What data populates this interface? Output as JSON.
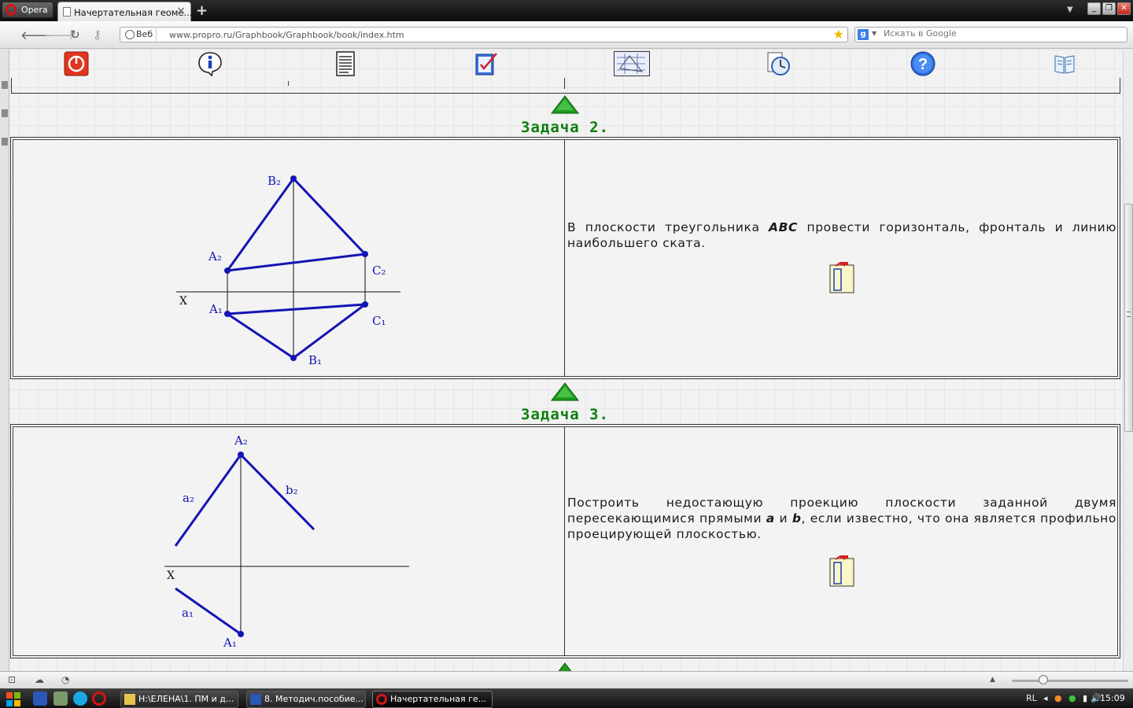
{
  "browser": {
    "menu_label": "Opera",
    "tab_title": "Начертательная геоме...",
    "tab_close": "×",
    "new_tab": "+",
    "nav_web_badge": "Веб",
    "url": "www.propro.ru/Graphbook/Graphbook/book/index.htm",
    "search_placeholder": "Искать в Google",
    "search_engine_letter": "g"
  },
  "toolbar": {
    "icons": [
      "power-icon",
      "info-icon",
      "document-icon",
      "checklist-icon",
      "drawing-thumbnail-icon",
      "clock-icon",
      "help-icon",
      "book-icon"
    ]
  },
  "tasks": [
    {
      "title": "Задача 2.",
      "text_before": "В плоскости треугольника ",
      "text_emph": "ABC",
      "text_after": " провести горизонталь, фронталь и линию наибольшего ската.",
      "labels": {
        "b2": "B₂",
        "a2": "A₂",
        "c2": "C₂",
        "x": "X",
        "a1": "A₁",
        "c1": "C₁",
        "b1": "B₁"
      }
    },
    {
      "title": "Задача 3.",
      "text_1": "Построить недостающую проекцию плоскости заданной двумя пересекающимися прямыми ",
      "text_a": "a",
      "text_2": " и ",
      "text_b": "b",
      "text_3": ", если известно, что она является профильно проецирующей плоскостью.",
      "labels": {
        "a2": "A₂",
        "a2_line": "a₂",
        "b2_line": "b₂",
        "x": "X",
        "a1_line": "a₁",
        "a1": "A₁"
      }
    }
  ],
  "colors": {
    "drawing_blue": "#1414b4",
    "title_green": "#0b7e0b",
    "arrow_green": "#1f9a1f"
  },
  "taskbar": {
    "items": [
      {
        "label": "H:\\ЕЛЕНА\\1. ПМ и д...",
        "icon": "folder-icon"
      },
      {
        "label": "8. Методич.пособие...",
        "icon": "word-icon"
      },
      {
        "label": "Начертательная ге...",
        "icon": "opera-icon"
      }
    ],
    "language": "RL",
    "clock": "15:09"
  }
}
